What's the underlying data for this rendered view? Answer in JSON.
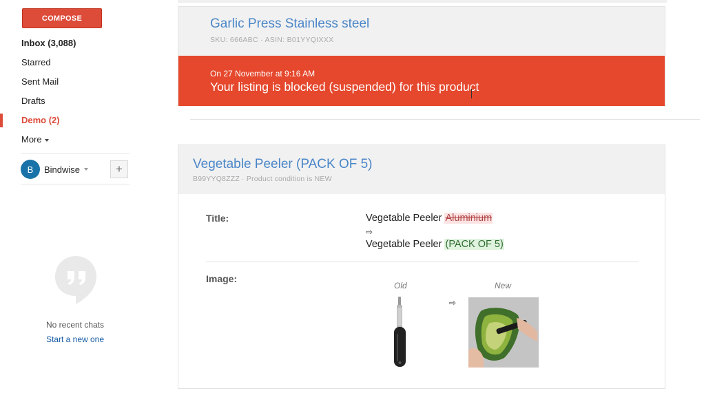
{
  "sidebar": {
    "compose_label": "COMPOSE",
    "items": [
      {
        "label": "Inbox (3,088)"
      },
      {
        "label": "Starred"
      },
      {
        "label": "Sent Mail"
      },
      {
        "label": "Drafts"
      },
      {
        "label": "Demo (2)"
      },
      {
        "label": "More"
      }
    ],
    "account": {
      "initial": "B",
      "name": "Bindwise",
      "add_label": "+"
    },
    "chats": {
      "empty_text": "No recent chats",
      "start_link": "Start a new one"
    }
  },
  "card1": {
    "title": "Garlic Press Stainless steel",
    "subtitle": "SKU: 666ABC  ·  ASIN: B01YYQIXXX",
    "banner": {
      "date": "On 27 November at 9:16 AM",
      "message": "Your listing is blocked (suspended) for this product",
      "color": "#e5482d"
    }
  },
  "card2": {
    "title": "Vegetable Peeler (PACK OF 5)",
    "subtitle": "B99YYQ8ZZZ  ·  Product condition is NEW",
    "title_row": {
      "label": "Title:",
      "old_prefix": "Vegetable Peeler ",
      "old_removed": "Aluminium",
      "arrow": "⇨",
      "new_prefix": "Vegetable Peeler ",
      "new_added": "(PACK OF 5)"
    },
    "image_row": {
      "label": "Image:",
      "old_caption": "Old",
      "new_caption": "New",
      "arrow": "⇨"
    }
  },
  "colors": {
    "accent": "#dd4b39",
    "link": "#4a86c8",
    "banner": "#e5482d"
  }
}
